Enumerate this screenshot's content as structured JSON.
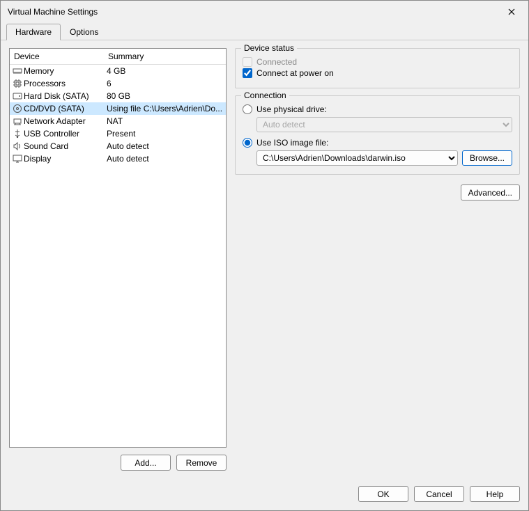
{
  "window": {
    "title": "Virtual Machine Settings"
  },
  "tabs": {
    "hardware": "Hardware",
    "options": "Options"
  },
  "list": {
    "header_device": "Device",
    "header_summary": "Summary",
    "rows": [
      {
        "name": "Memory",
        "summary": "4 GB",
        "icon": "memory"
      },
      {
        "name": "Processors",
        "summary": "6",
        "icon": "cpu"
      },
      {
        "name": "Hard Disk (SATA)",
        "summary": "80 GB",
        "icon": "disk"
      },
      {
        "name": "CD/DVD (SATA)",
        "summary": "Using file C:\\Users\\Adrien\\Do...",
        "icon": "cd",
        "selected": true
      },
      {
        "name": "Network Adapter",
        "summary": "NAT",
        "icon": "net"
      },
      {
        "name": "USB Controller",
        "summary": "Present",
        "icon": "usb"
      },
      {
        "name": "Sound Card",
        "summary": "Auto detect",
        "icon": "sound"
      },
      {
        "name": "Display",
        "summary": "Auto detect",
        "icon": "display"
      }
    ]
  },
  "buttons": {
    "add": "Add...",
    "remove": "Remove",
    "browse": "Browse...",
    "advanced": "Advanced...",
    "ok": "OK",
    "cancel": "Cancel",
    "help": "Help"
  },
  "device_status": {
    "title": "Device status",
    "connected": "Connected",
    "connect_power_on": "Connect at power on"
  },
  "connection": {
    "title": "Connection",
    "use_physical": "Use physical drive:",
    "physical_value": "Auto detect",
    "use_iso": "Use ISO image file:",
    "iso_value": "C:\\Users\\Adrien\\Downloads\\darwin.iso"
  }
}
